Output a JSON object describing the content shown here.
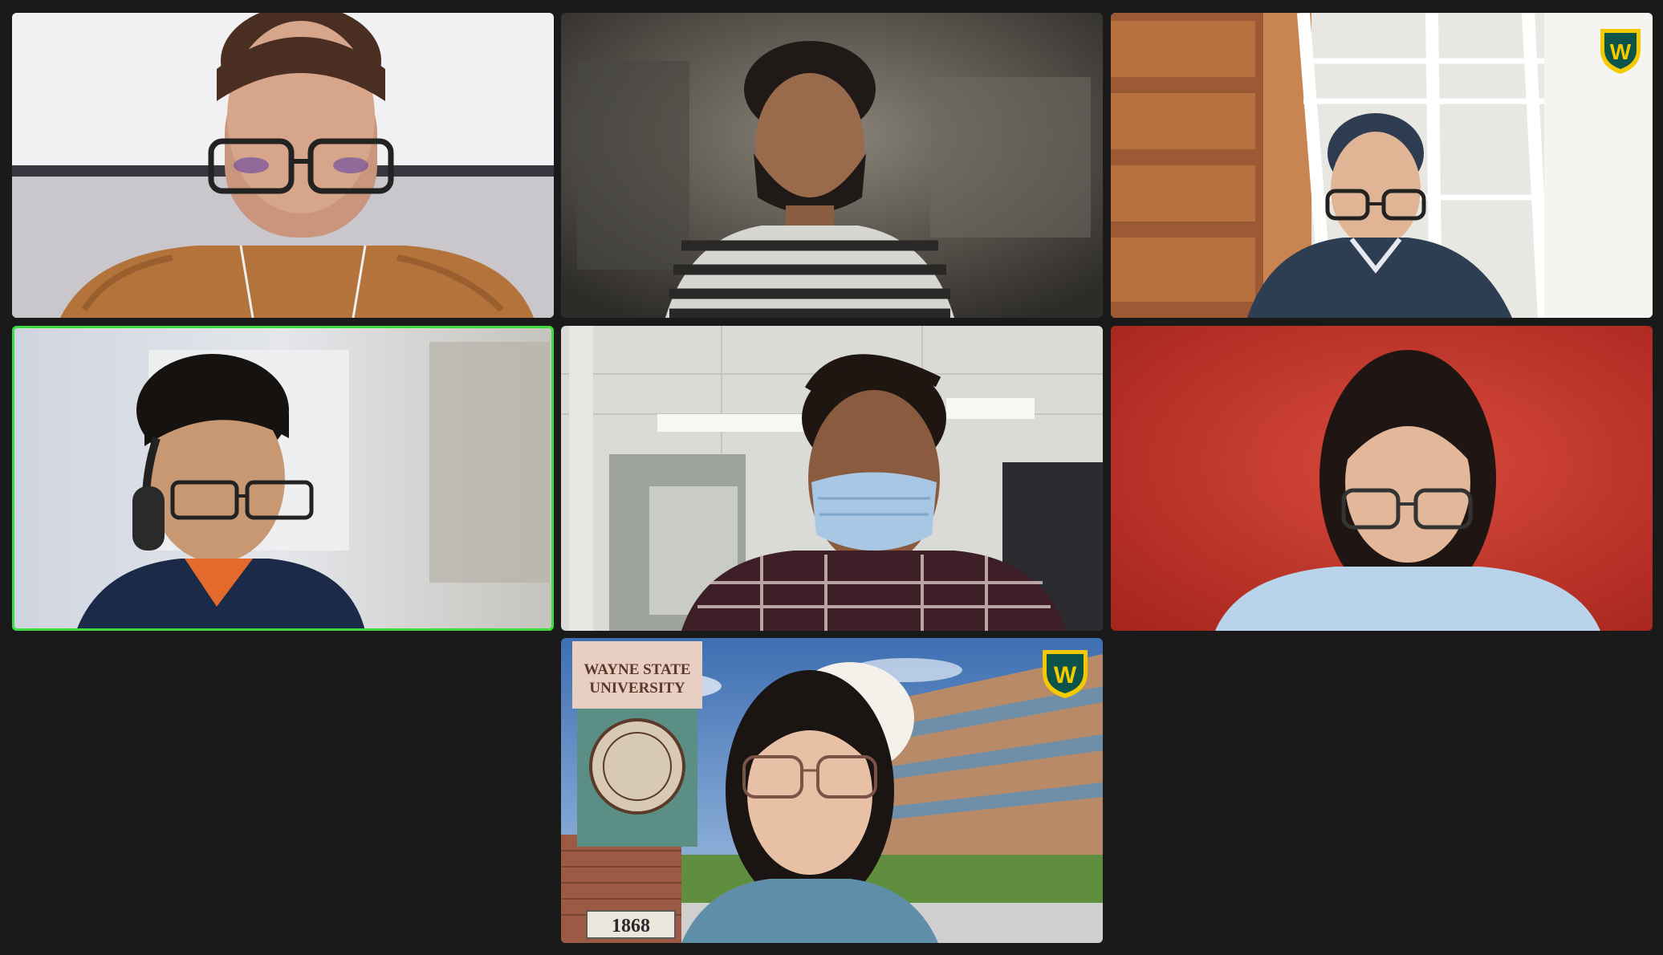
{
  "meeting": {
    "participant_count": 7,
    "active_speaker_index": 4
  },
  "tiles": [
    {
      "id": "p1",
      "background": "office-wall",
      "glasses": true
    },
    {
      "id": "p2",
      "background": "blurred-room",
      "glasses": false
    },
    {
      "id": "p3",
      "background": "atrium-virtual",
      "glasses": true
    },
    {
      "id": "p4",
      "background": "blurred-window",
      "glasses": true,
      "headset": true
    },
    {
      "id": "p5",
      "background": "laboratory",
      "glasses": false,
      "mask": true
    },
    {
      "id": "p6",
      "background": "red-wall",
      "glasses": true
    },
    {
      "id": "p7",
      "background": "campus-virtual",
      "glasses": true
    }
  ],
  "campus_sign": {
    "line1": "WAYNE STATE",
    "line2": "UNIVERSITY",
    "year": "1868"
  },
  "logo": {
    "letter": "W",
    "icon": "wayne-state-shield-icon"
  },
  "colors": {
    "background": "#1a1a1a",
    "speaker_outline": "#3ddc3d",
    "logo_green": "#0c5449",
    "logo_gold": "#f3c900"
  }
}
